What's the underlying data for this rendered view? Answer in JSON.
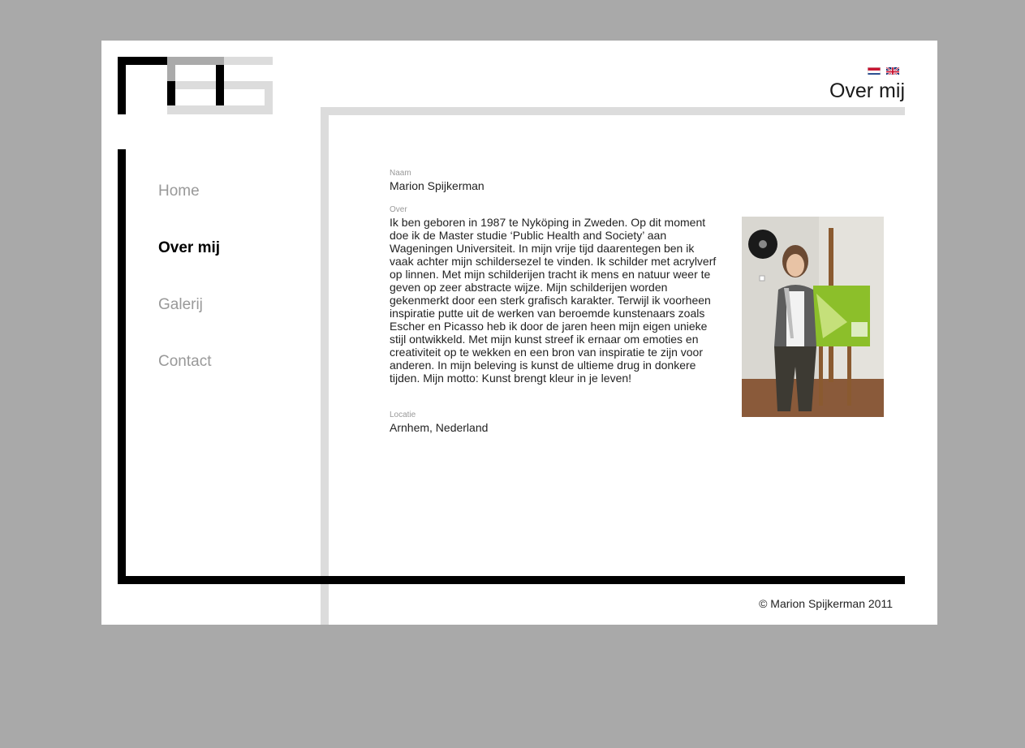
{
  "site": {
    "logo_name": "MS logo",
    "languages": [
      {
        "code": "nl",
        "icon": "dutch-flag-icon"
      },
      {
        "code": "en",
        "icon": "uk-flag-icon"
      }
    ]
  },
  "header": {
    "page_title": "Over mij"
  },
  "nav": {
    "items": [
      {
        "label": "Home",
        "active": false
      },
      {
        "label": "Over mij",
        "active": true
      },
      {
        "label": "Galerij",
        "active": false
      },
      {
        "label": "Contact",
        "active": false
      }
    ]
  },
  "profile": {
    "naam_label": "Naam",
    "naam_value": "Marion Spijkerman",
    "over_label": "Over",
    "over_text": "Ik ben geboren in 1987 te Nyköping in Zweden. Op dit moment doe ik de Master studie ‘Public Health and Society’ aan Wageningen Universiteit. In mijn vrije tijd daarentegen ben ik vaak achter mijn schildersezel te vinden. Ik schilder met acrylverf op linnen. Met mijn schilderijen tracht ik mens en natuur weer te geven op zeer abstracte wijze. Mijn schilderijen worden gekenmerkt door een sterk grafisch karakter. Terwijl ik voorheen inspiratie putte uit de werken van beroemde kunstenaars zoals Escher en Picasso heb ik door de jaren heen mijn eigen unieke stijl ontwikkeld. Met mijn kunst streef ik ernaar om emoties en creativiteit op te wekken en een bron van inspiratie te zijn voor anderen. In mijn beleving is kunst de ultieme drug in donkere tijden. Mijn motto: Kunst brengt kleur in je leven!",
    "locatie_label": "Locatie",
    "locatie_value": "Arnhem, Nederland"
  },
  "footer": {
    "copyright": "© Marion Spijkerman 2011"
  },
  "colors": {
    "background": "#a9a9a9",
    "page": "#ffffff",
    "frame_dark": "#000000",
    "frame_light": "#dcdcdc",
    "nav_inactive": "#999999",
    "nav_active": "#000000"
  }
}
